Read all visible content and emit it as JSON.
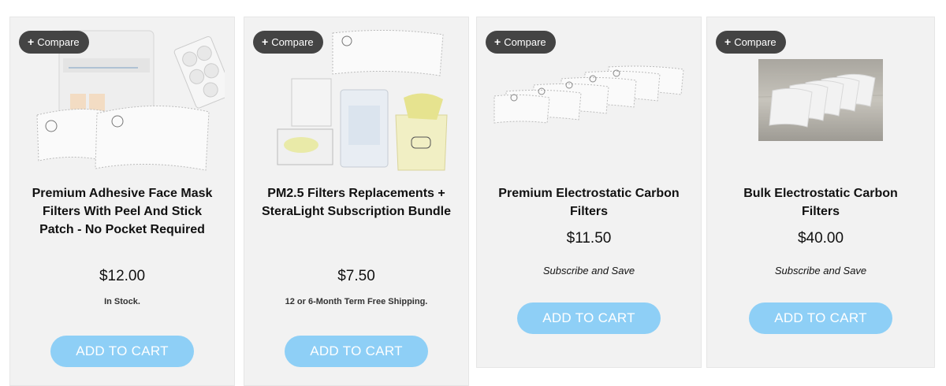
{
  "products": [
    {
      "compare_label": "Compare",
      "title": "Premium Adhesive Face Mask Filters With Peel And Stick Patch - No Pocket Required",
      "price": "$12.00",
      "note": "In Stock.",
      "cart_label": "ADD TO CART",
      "image": "adhesive-mask-filters-with-package"
    },
    {
      "compare_label": "Compare",
      "title": "PM2.5 Filters Replacements + SteraLight Subscription Bundle",
      "price": "$7.50",
      "note": "12 or 6-Month Term Free Shipping.",
      "cart_label": "ADD TO CART",
      "image": "filters-with-steralight-bundle"
    },
    {
      "compare_label": "Compare",
      "title": "Premium Electrostatic Carbon Filters",
      "price": "$11.50",
      "note": "Subscribe and Save",
      "cart_label": "ADD TO CART",
      "image": "fanned-carbon-filters"
    },
    {
      "compare_label": "Compare",
      "title": "Bulk Electrostatic Carbon Filters",
      "price": "$40.00",
      "note": "Subscribe and Save",
      "cart_label": "ADD TO CART",
      "image": "filters-on-wood-photo"
    }
  ],
  "colors": {
    "card_bg": "#f2f2f2",
    "compare_bg": "#444444",
    "cart_bg": "#8ecff6"
  },
  "icons": {
    "compare": "plus-icon"
  }
}
